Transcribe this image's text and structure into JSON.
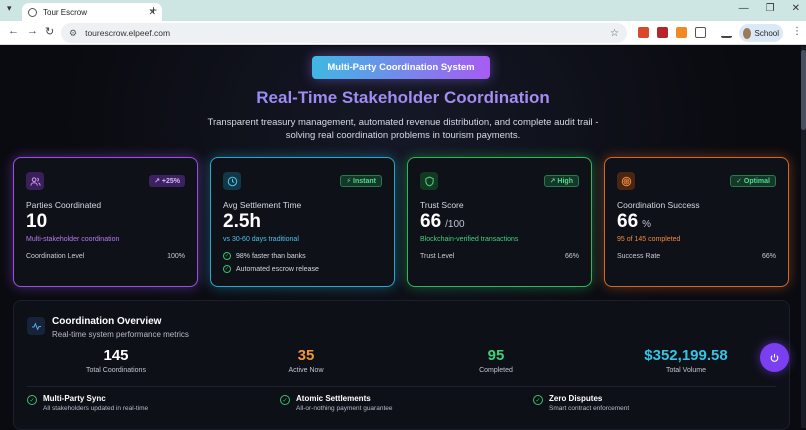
{
  "browser": {
    "tab_title": "Tour Escrow",
    "url": "tourescrow.elpeef.com",
    "profile_label": "School"
  },
  "hero": {
    "badge": "Multi-Party Coordination System",
    "title": "Real-Time Stakeholder Coordination",
    "subtitle": "Transparent treasury management, automated revenue distribution, and complete audit trail - solving real coordination problems in tourism payments."
  },
  "cards": [
    {
      "icon": "users-icon",
      "pill": "↗ +25%",
      "label": "Parties Coordinated",
      "value": "10",
      "unit": "",
      "sub": "Multi-stakeholder coordination",
      "row_label": "Coordination Level",
      "row_value": "100%",
      "accent": "#9c4fe6"
    },
    {
      "icon": "clock-icon",
      "pill": "⚡ Instant",
      "label": "Avg Settlement Time",
      "value": "2.5h",
      "unit": "",
      "sub": "vs 30-60 days traditional",
      "checks": [
        "98% faster than banks",
        "Automated escrow release"
      ],
      "accent": "#2aa7c9"
    },
    {
      "icon": "shield-icon",
      "pill": "↗ High",
      "label": "Trust Score",
      "value": "66",
      "unit": "/100",
      "sub": "Blockchain-verified transactions",
      "row_label": "Trust Level",
      "row_value": "66%",
      "accent": "#2fb85a"
    },
    {
      "icon": "target-icon",
      "pill": "✓ Optimal",
      "label": "Coordination Success",
      "value": "66",
      "unit": "%",
      "sub": "95 of 145 completed",
      "row_label": "Success Rate",
      "row_value": "66%",
      "accent": "#d2672a"
    }
  ],
  "overview": {
    "title": "Coordination Overview",
    "subtitle": "Real-time system performance metrics",
    "stats": [
      {
        "value": "145",
        "label": "Total Coordinations",
        "color": "#ffffff"
      },
      {
        "value": "35",
        "label": "Active Now",
        "color": "#f0953a"
      },
      {
        "value": "95",
        "label": "Completed",
        "color": "#3fd07a"
      },
      {
        "value": "$352,199.58",
        "label": "Total Volume",
        "color": "#34c4e6"
      }
    ],
    "features": [
      {
        "title": "Multi-Party Sync",
        "desc": "All stakeholders updated in real-time"
      },
      {
        "title": "Atomic Settlements",
        "desc": "All-or-nothing payment guarantee"
      },
      {
        "title": "Zero Disputes",
        "desc": "Smart contract enforcement"
      }
    ]
  }
}
